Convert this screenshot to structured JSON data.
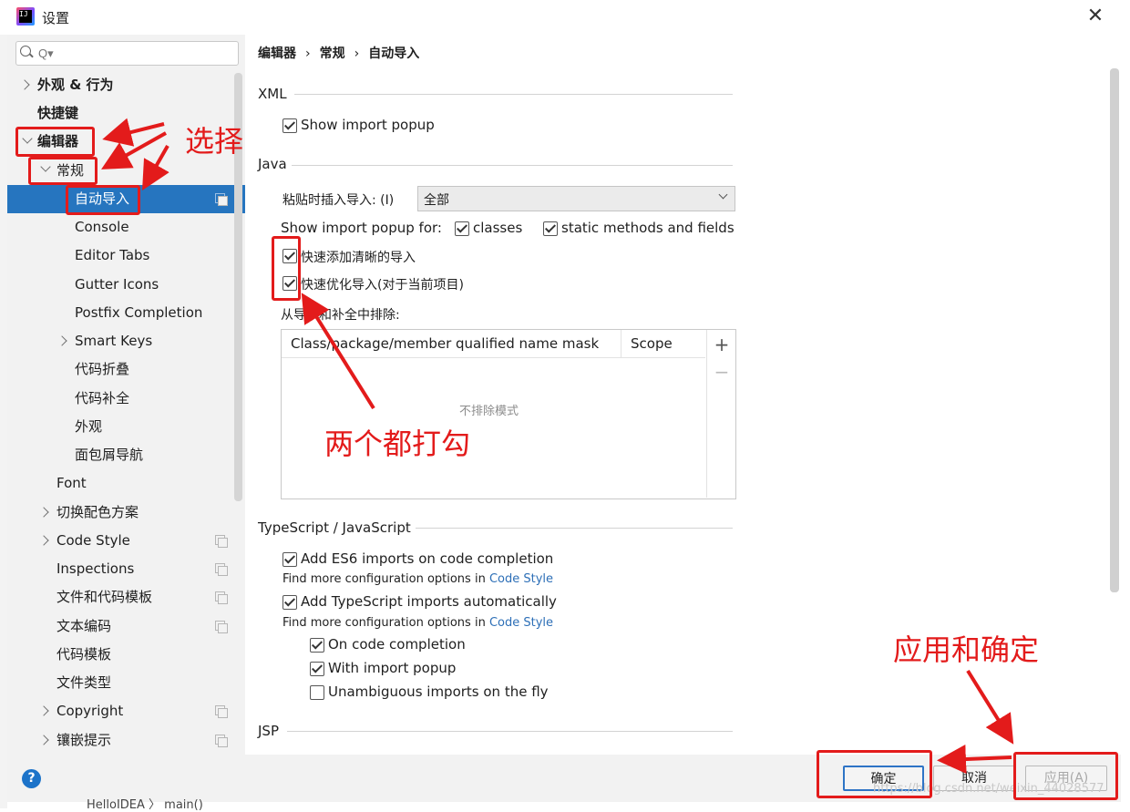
{
  "window": {
    "title": "设置"
  },
  "search": {
    "placeholder": "Q▾"
  },
  "sidebar": {
    "items": [
      {
        "label": "外观 & 行为"
      },
      {
        "label": "快捷键"
      },
      {
        "label": "编辑器"
      },
      {
        "label": "常规"
      },
      {
        "label": "自动导入"
      },
      {
        "label": "Console"
      },
      {
        "label": "Editor Tabs"
      },
      {
        "label": "Gutter Icons"
      },
      {
        "label": "Postfix Completion"
      },
      {
        "label": "Smart Keys"
      },
      {
        "label": "代码折叠"
      },
      {
        "label": "代码补全"
      },
      {
        "label": "外观"
      },
      {
        "label": "面包屑导航"
      },
      {
        "label": "Font"
      },
      {
        "label": "切换配色方案"
      },
      {
        "label": "Code Style"
      },
      {
        "label": "Inspections"
      },
      {
        "label": "文件和代码模板"
      },
      {
        "label": "文本编码"
      },
      {
        "label": "代码模板"
      },
      {
        "label": "文件类型"
      },
      {
        "label": "Copyright"
      },
      {
        "label": "镶嵌提示"
      }
    ]
  },
  "breadcrumb": {
    "a": "编辑器",
    "b": "常规",
    "c": "自动导入",
    "sep": "›"
  },
  "xml": {
    "title": "XML",
    "show_popup": "Show import popup"
  },
  "java": {
    "title": "Java",
    "paste_label": "粘贴时插入导入:",
    "paste_mnemonic": "(I)",
    "paste_value": "全部",
    "popup_for_label": "Show import popup for:",
    "classes_label": "classes",
    "static_label": "static methods and fields",
    "add_unambiguous": "快速添加清晰的导入",
    "optimize": "快速优化导入(对于当前项目)",
    "exclude_label": "从导入和补全中排除:",
    "col_mask": "Class/package/member qualified name mask",
    "col_scope": "Scope",
    "empty_text": "不排除模式",
    "add_icon": "+",
    "remove_icon": "−"
  },
  "ts": {
    "title": "TypeScript / JavaScript",
    "es6": "Add ES6 imports on code completion",
    "find_more": "Find more configuration options in ",
    "code_style_link": "Code Style",
    "ts_auto": "Add TypeScript imports automatically",
    "find_more2": "Find more configuration options in ",
    "code_style_link2": "Code Style",
    "on_completion": "On code completion",
    "with_popup": "With import popup",
    "unambiguous_fly": "Unambiguous imports on the fly"
  },
  "jsp": {
    "title": "JSP"
  },
  "buttons": {
    "ok": "确定",
    "cancel": "取消",
    "apply": "应用(A)",
    "help": "?"
  },
  "annotations": {
    "select": "选择",
    "both_check": "两个都打勾",
    "apply_ok": "应用和确定"
  },
  "behind": {
    "editor_crumb": "HelloIDEA 〉 main()"
  },
  "watermark": "https://blog.csdn.net/weixin_44028577",
  "colors": {
    "accent": "#2675bf",
    "annotation": "#e31b1b",
    "link": "#2d6fb7"
  }
}
